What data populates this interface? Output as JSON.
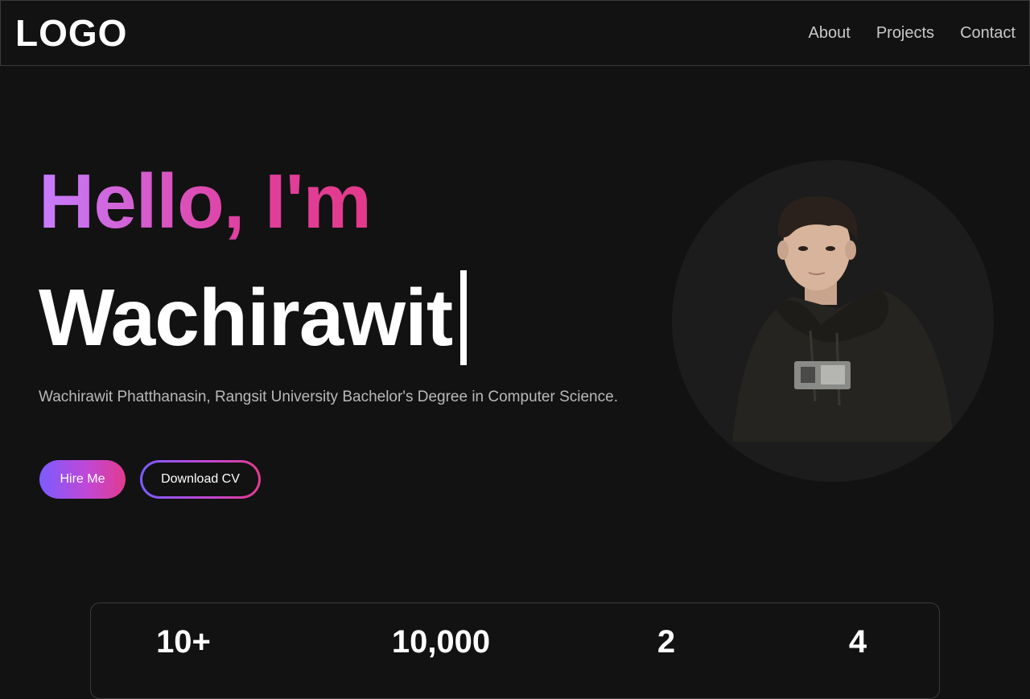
{
  "nav": {
    "logo": "LOGO",
    "links": [
      "About",
      "Projects",
      "Contact"
    ]
  },
  "hero": {
    "greeting": "Hello, I'm",
    "name": "Wachirawit",
    "bio": "Wachirawit Phatthanasin, Rangsit University Bachelor's Degree in Computer Science.",
    "hire_button": "Hire Me",
    "cv_button": "Download CV"
  },
  "stats": [
    "10+",
    "10,000",
    "2",
    "4"
  ],
  "colors": {
    "background": "#121212",
    "gradient_start": "#c77dff",
    "gradient_end": "#e33a8a",
    "button_gradient_start": "#7b5cff",
    "button_gradient_end": "#e13b8f",
    "muted_text": "#b9b9b9"
  }
}
